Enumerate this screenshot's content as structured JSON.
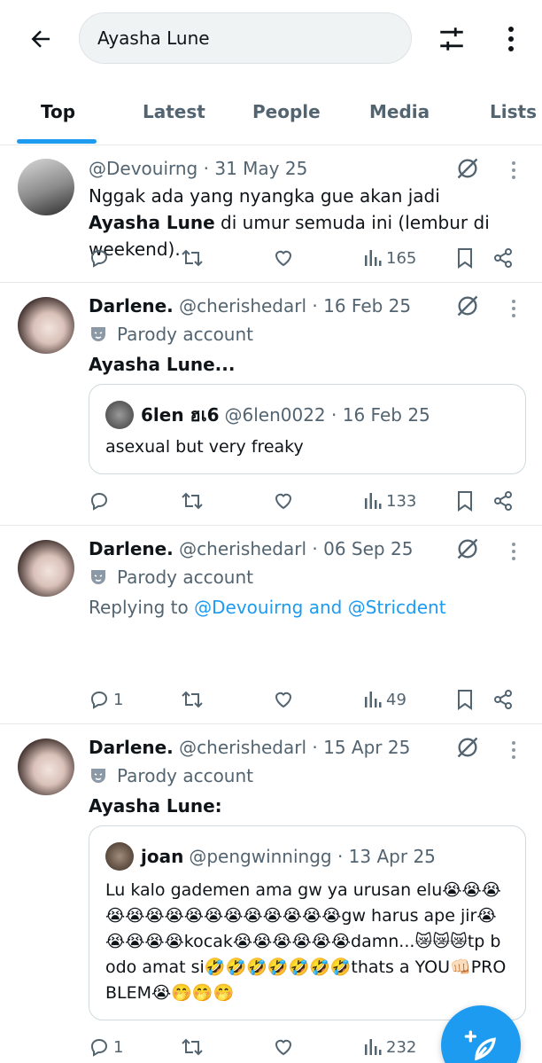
{
  "search": {
    "query": "Ayasha Lune"
  },
  "tabs": [
    {
      "label": "Top"
    },
    {
      "label": "Latest"
    },
    {
      "label": "People"
    },
    {
      "label": "Media"
    },
    {
      "label": "Lists"
    }
  ],
  "tweets": [
    {
      "name": "",
      "handle": "@Devouirng",
      "date": "· 31 May 25",
      "text_parts": [
        "Nggak ada yang nyangka gue akan jadi ",
        "Ayasha Lune",
        " di umur semuda ini (lembur di weekend)."
      ],
      "replies": "",
      "views": "165"
    },
    {
      "name": "Darlene.",
      "handle": "@cherishedarl",
      "date": "· 16 Feb 25",
      "parody": "Parody account",
      "text": "Ayasha Lune...",
      "quote": {
        "name": "6len ฮเ6",
        "handle": "@6len0022",
        "date": "· 16 Feb 25",
        "text": "asexual but very freaky"
      },
      "replies": "",
      "views": "133"
    },
    {
      "name": "Darlene.",
      "handle": "@cherishedarl",
      "date": "· 06 Sep 25",
      "parody": "Parody account",
      "reply_prefix": "Replying to ",
      "reply_mentions": "@Devouirng and @Stricdent",
      "replies": "1",
      "views": "49"
    },
    {
      "name": "Darlene.",
      "handle": "@cherishedarl",
      "date": "· 15 Apr 25",
      "parody": "Parody account",
      "text": "Ayasha Lune:",
      "quote": {
        "name": "joan",
        "handle": "@pengwinningg",
        "date": "· 13 Apr 25",
        "text": "Lu kalo gademen ama gw ya urusan elu😭😭😭😭😭😭😭😭😭😭😭😭😭😭😭gw harus ape jir😭😭😭😭😭kocak😭😭😭😭😭😭damn...😿😿😿tp bodo amat si🤣🤣🤣🤣🤣🤣🤣thats a YOU👊🏻PROBLEM😭🤭🤭🤭"
      },
      "replies": "1",
      "views": "232"
    }
  ],
  "colors": {
    "accent": "#1d9bf0",
    "text": "#0f1419",
    "muted": "#536471"
  },
  "icons": [
    "back-arrow-icon",
    "filter-sliders-icon",
    "more-vertical-icon",
    "grok-icon",
    "reply-icon",
    "retweet-icon",
    "like-icon",
    "views-icon",
    "bookmark-icon",
    "share-icon",
    "parody-mask-icon",
    "compose-icon"
  ]
}
